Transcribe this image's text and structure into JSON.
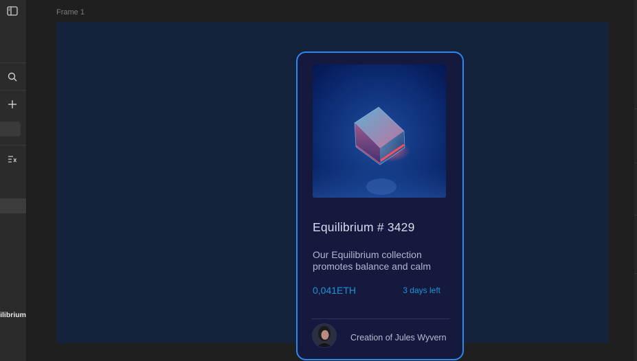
{
  "editor": {
    "frame_label": "Frame 1",
    "layer_label": "Equilibrium"
  },
  "left_panel": {
    "icons": [
      "sidebar-toggle-icon",
      "search-icon",
      "plus-icon",
      "text-list-icon"
    ]
  },
  "card": {
    "title": "Equilibrium # 3429",
    "description": "Our Equilibrium collection promotes balance and calm",
    "price": "0,041ETH",
    "time_left": "3 days left",
    "creator": "Creation of Jules Wyvern",
    "accent_color": "#2a8af0",
    "link_color": "#1c94d8",
    "background_color": "#15193e"
  }
}
